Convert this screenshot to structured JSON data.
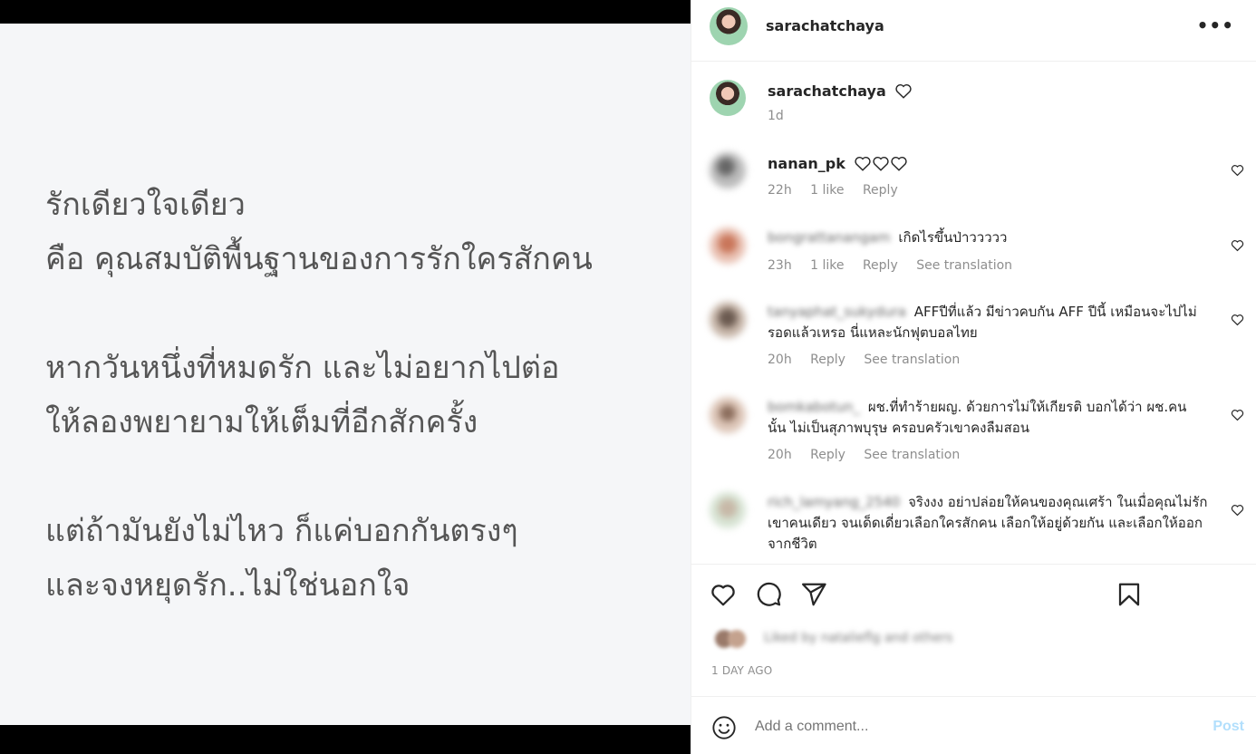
{
  "post_image": {
    "lines": [
      "รักเดียวใจเดียว",
      "คือ คุณสมบัติพื้นฐานของการรักใครสักคน",
      "หากวันหนึ่งที่หมดรัก และไม่อยากไปต่อ",
      "ให้ลองพยายามให้เต็มที่อีกสักครั้ง",
      "แต่ถ้ามันยังไม่ไหว ก็แค่บอกกันตรงๆ",
      "และจงหยุดรัก..ไม่ใช่นอกใจ"
    ]
  },
  "header": {
    "username": "sarachatchaya",
    "more_label": "•••"
  },
  "caption": {
    "username": "sarachatchaya",
    "time": "1d"
  },
  "comments": [
    {
      "username": "nanan_pk",
      "text": "",
      "time": "22h",
      "likes": "1 like",
      "reply": "Reply"
    },
    {
      "username": "bongrattanangam",
      "text": "เกิดไรขึ้นป่าววววว",
      "time": "23h",
      "likes": "1 like",
      "reply": "Reply",
      "translate": "See translation"
    },
    {
      "username": "tanyaphat_sukydura",
      "text": "AFFปีที่แล้ว มีข่าวคบกัน AFF ปีนี้ เหมือนจะไปไม่รอดแล้วเหรอ นี่แหละนักฟุตบอลไทย",
      "time": "20h",
      "reply": "Reply",
      "translate": "See translation"
    },
    {
      "username": "bomkabotun_",
      "text": "ผช.ที่ทำร้ายผญ. ด้วยการไม่ให้เกียรติ บอกได้ว่า ผช.คนนั้น ไม่เป็นสุภาพบุรุษ ครอบครัวเขาคงลืมสอน",
      "time": "20h",
      "reply": "Reply",
      "translate": "See translation"
    },
    {
      "username": "rich_lamyang_2540",
      "text": "จริงงง อย่าปล่อยให้คนของคุณเศร้า ในเมื่อคุณไม่รักเขาคนเดียว จนเด็ดเดี่ยวเลือกใครสักคน เลือกให้อยู่ด้วยกัน และเลือกให้ออกจากชีวิต"
    }
  ],
  "liked_by": "Liked by natalieflg and others",
  "posted_ago": "1 DAY AGO",
  "add_comment": {
    "placeholder": "Add a comment...",
    "post_label": "Post"
  },
  "icons": [
    "heart-icon",
    "comment-icon",
    "share-icon",
    "bookmark-icon",
    "emoji-icon",
    "more-icon"
  ]
}
